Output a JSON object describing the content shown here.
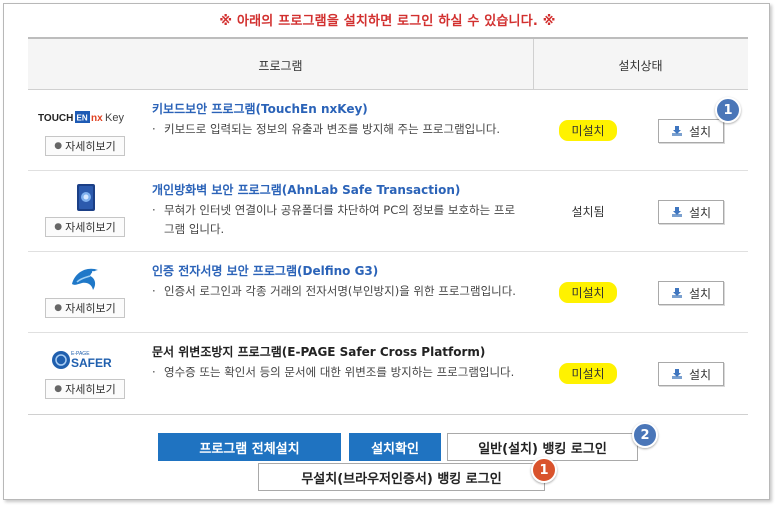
{
  "notice": "※ 아래의 프로그램을 설치하면 로그인 하실 수 있습니다. ※",
  "table": {
    "col_program": "프로그램",
    "col_status": "설치상태"
  },
  "rows": [
    {
      "logo": "touchen-nxkey-logo",
      "logo_text": "TOUCH EN nxKey",
      "detail_label": "자세히보기",
      "title": "키보드보안 프로그램(TouchEn nxKey)",
      "desc": "키보드로 입력되는 정보의 유출과 변조를 방지해 주는 프로그램입니다.",
      "status": "미설치",
      "highlighted": true,
      "install_label": "설치"
    },
    {
      "logo": "ahnlab-safe-transaction-logo",
      "detail_label": "자세히보기",
      "title": "개인방화벽 보안 프로그램(AhnLab Safe Transaction)",
      "desc": "무혀가 인터넷 연결이나 공유폴더를 차단하여 PC의 정보를 보호하는 프로그램 입니다.",
      "status": "설치됨",
      "highlighted": false,
      "install_label": "설치"
    },
    {
      "logo": "delfino-dolphin-logo",
      "detail_label": "자세히보기",
      "title": "인증 전자서명 보안 프로그램(Delfino G3)",
      "desc": "인증서 로그인과 각종 거래의 전자서명(부인방지)을 위한 프로그램입니다.",
      "status": "미설치",
      "highlighted": true,
      "install_label": "설치"
    },
    {
      "logo": "safer-logo",
      "logo_text": "SAFER",
      "logo_subtext": "E-PAGE",
      "detail_label": "자세히보기",
      "title": "문서 위변조방지 프로그램(E-PAGE Safer Cross Platform)",
      "desc": "영수증 또는 확인서 등의 문서에 대한 위변조를 방지하는 프로그램입니다.",
      "status": "미설치",
      "highlighted": true,
      "install_label": "설치"
    }
  ],
  "buttons": {
    "install_all": "프로그램 전체설치",
    "confirm": "설치확인",
    "normal_login": "일반(설치) 뱅킹 로그인",
    "noinstall_login": "무설치(브라우저인증서) 뱅킹 로그인"
  },
  "badges": {
    "row1": "1",
    "normal_login": "2",
    "noinstall_login": "1"
  },
  "colors": {
    "notice": "#d2302f",
    "title": "#2b63b8",
    "highlight": "#fff200",
    "primary_button": "#1f73c1",
    "badge_blue": "#4a76b8",
    "badge_red": "#d9532c"
  }
}
